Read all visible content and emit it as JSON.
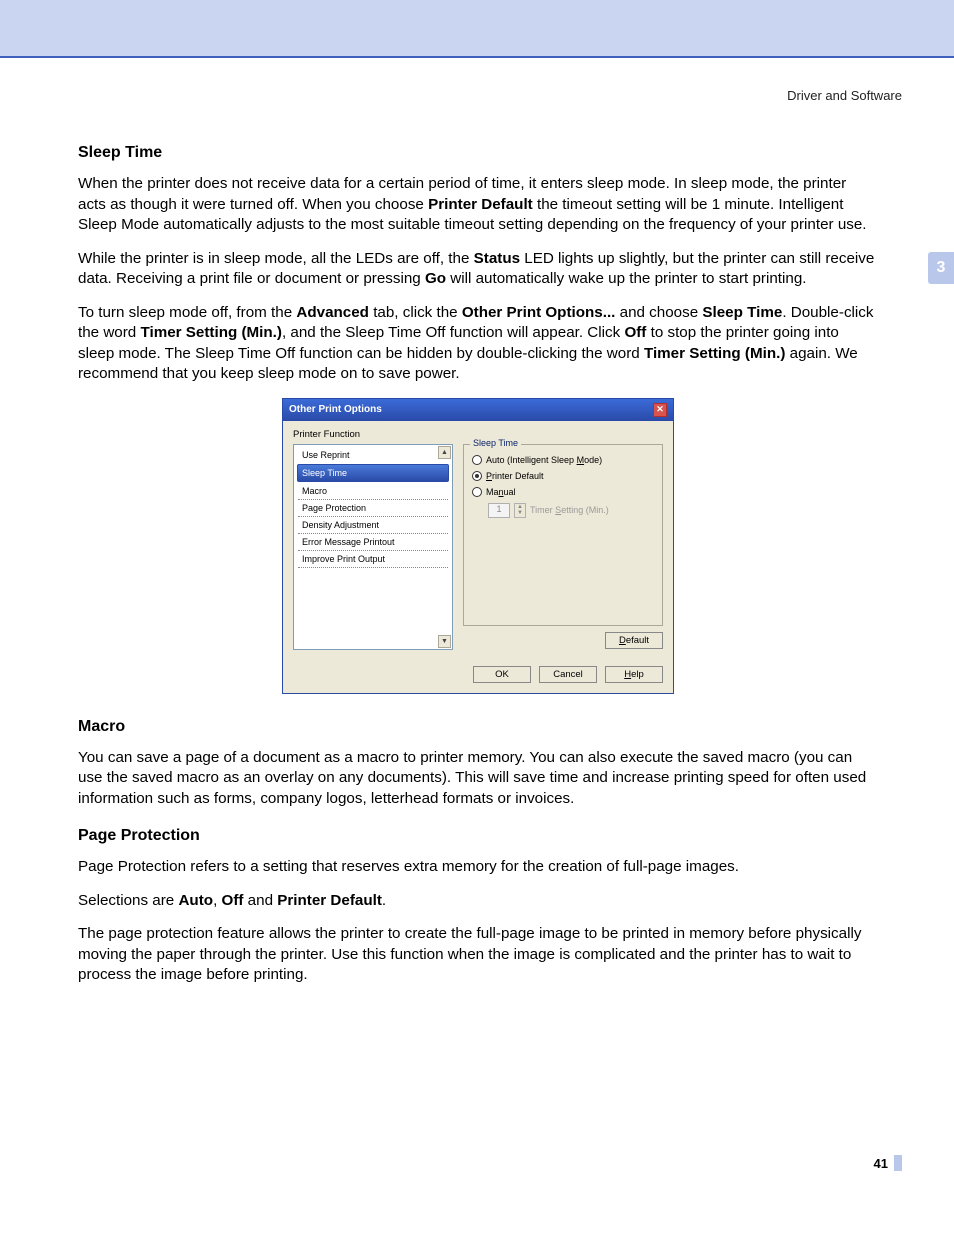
{
  "header": {
    "breadcrumb": "Driver and Software"
  },
  "side_tab": "3",
  "page_number": "41",
  "s1": {
    "heading": "Sleep Time",
    "p1_a": "When the printer does not receive data for a certain period of time, it enters sleep mode. In sleep mode, the printer acts as though it were turned off. When you choose ",
    "p1_b": "Printer Default",
    "p1_c": " the timeout setting will be 1 minute. Intelligent Sleep Mode automatically adjusts to the most suitable timeout setting depending on the frequency of your printer use.",
    "p2_a": "While the printer is in sleep mode, all the LEDs are off, the ",
    "p2_b": "Status",
    "p2_c": " LED lights up slightly, but the printer can still receive data. Receiving a print file or document or pressing ",
    "p2_d": "Go",
    "p2_e": " will automatically wake up the printer to start printing.",
    "p3_a": "To turn sleep mode off, from the ",
    "p3_b": "Advanced",
    "p3_c": " tab, click the ",
    "p3_d": "Other Print Options...",
    "p3_e": " and choose ",
    "p3_f": "Sleep Time",
    "p3_g": ". Double-click the word ",
    "p3_h": "Timer Setting (Min.)",
    "p3_i": ", and the Sleep Time Off function will appear. Click ",
    "p3_j": "Off",
    "p3_k": " to stop the printer going into sleep mode. The Sleep Time Off function can be hidden by double-clicking the word ",
    "p3_l": "Timer Setting (Min.)",
    "p3_m": " again. We recommend that you keep sleep mode on to save power."
  },
  "dialog": {
    "title": "Other Print Options",
    "section_label": "Printer Function",
    "items": {
      "i0": "Use Reprint",
      "i1": "Sleep Time",
      "i2": "Macro",
      "i3": "Page Protection",
      "i4": "Density Adjustment",
      "i5": "Error Message Printout",
      "i6": "Improve Print Output"
    },
    "group_title": "Sleep Time",
    "radios": {
      "r0_a": "Auto (Intelligent Sleep ",
      "r0_b": "M",
      "r0_c": "ode)",
      "r1_a": "P",
      "r1_b": "rinter Default",
      "r2_a": "Ma",
      "r2_b": "n",
      "r2_c": "ual"
    },
    "timer_value": "1",
    "timer_label_a": "Timer ",
    "timer_label_b": "S",
    "timer_label_c": "etting (Min.)",
    "buttons": {
      "default_a": "D",
      "default_b": "efault",
      "ok": "OK",
      "cancel": "Cancel",
      "help_a": "H",
      "help_b": "elp"
    }
  },
  "s2": {
    "heading": "Macro",
    "p1": "You can save a page of a document as a macro to printer memory. You can also execute the saved macro (you can use the saved macro as an overlay on any documents). This will save time and increase printing speed for often used information such as forms, company logos, letterhead formats or invoices."
  },
  "s3": {
    "heading": "Page Protection",
    "p1": "Page Protection refers to a setting that reserves extra memory for the creation of full-page images.",
    "p2_a": "Selections are ",
    "p2_b": "Auto",
    "p2_c": ", ",
    "p2_d": "Off",
    "p2_e": " and ",
    "p2_f": "Printer Default",
    "p2_g": ".",
    "p3": "The page protection feature allows the printer to create the full-page image to be printed in memory before physically moving the paper through the printer. Use this function when the image is complicated and the printer has to wait to process the image before printing."
  }
}
